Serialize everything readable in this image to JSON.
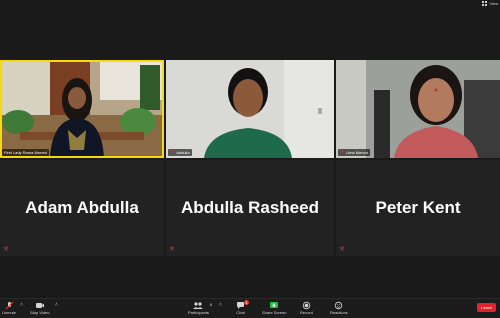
{
  "top": {
    "view_label": "View"
  },
  "tiles": [
    {
      "name": "First Lady Rama Ahmed",
      "type": "video"
    },
    {
      "name": "Abdulla",
      "type": "video"
    },
    {
      "name": "Uma Menon",
      "type": "video"
    },
    {
      "name": "Adam Abdulla",
      "type": "name"
    },
    {
      "name": "Abdulla Rasheed",
      "type": "name"
    },
    {
      "name": "Peter Kent",
      "type": "name"
    }
  ],
  "toolbar": {
    "unmute": "Unmute",
    "stop_video": "Stop Video",
    "participants": "Participants",
    "participants_count": "6",
    "chat": "Chat",
    "chat_badge": "1",
    "share_screen": "Share Screen",
    "record": "Record",
    "reactions": "Reactions",
    "leave": "Leave"
  },
  "colors": {
    "active_speaker": "#f5d90a",
    "share_green": "#1fbf43",
    "leave_red": "#e0242f",
    "muted_red": "#e53935"
  }
}
